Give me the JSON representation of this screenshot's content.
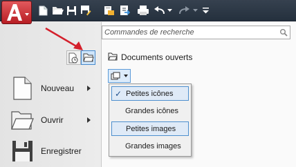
{
  "toolbar": {
    "app_button_letter": "A",
    "quick_access": [
      {
        "icon": "new-icon"
      },
      {
        "icon": "open-icon"
      },
      {
        "icon": "save-icon"
      },
      {
        "icon": "save-as-icon"
      },
      {
        "icon": "open-sheet-set-icon"
      },
      {
        "icon": "publish-icon"
      },
      {
        "icon": "plot-icon"
      },
      {
        "icon": "undo-icon"
      },
      {
        "icon": "redo-icon"
      },
      {
        "icon": "customize-qat-icon"
      }
    ]
  },
  "search": {
    "placeholder": "Commandes de recherche",
    "value": ""
  },
  "menu": {
    "items": [
      {
        "label": "Nouveau",
        "icon": "new-document-icon",
        "has_submenu": true
      },
      {
        "label": "Ouvrir",
        "icon": "folder-icon",
        "has_submenu": true
      },
      {
        "label": "Enregistrer",
        "icon": "floppy-disk-icon",
        "has_submenu": false
      }
    ]
  },
  "view_modes": {
    "recent_documents": {
      "icon": "recent-documents-icon",
      "selected": false
    },
    "open_documents": {
      "icon": "open-documents-icon",
      "selected": true
    }
  },
  "content": {
    "section_title": "Documents ouverts"
  },
  "display_dropdown": {
    "options": [
      {
        "label": "Petites icônes",
        "checked": true,
        "highlighted": true
      },
      {
        "label": "Grandes icônes",
        "checked": false,
        "highlighted": false
      },
      {
        "label": "Petites images",
        "checked": false,
        "highlighted": true
      },
      {
        "label": "Grandes images",
        "checked": false,
        "highlighted": false
      }
    ],
    "check_mark": "✓"
  },
  "colors": {
    "app_button": "#c8262d",
    "toolbar_bg": "#2e3946",
    "selection_border": "#4d8fce",
    "selection_fill": "#dfeaf7",
    "annotation_arrow": "#d4202c"
  }
}
